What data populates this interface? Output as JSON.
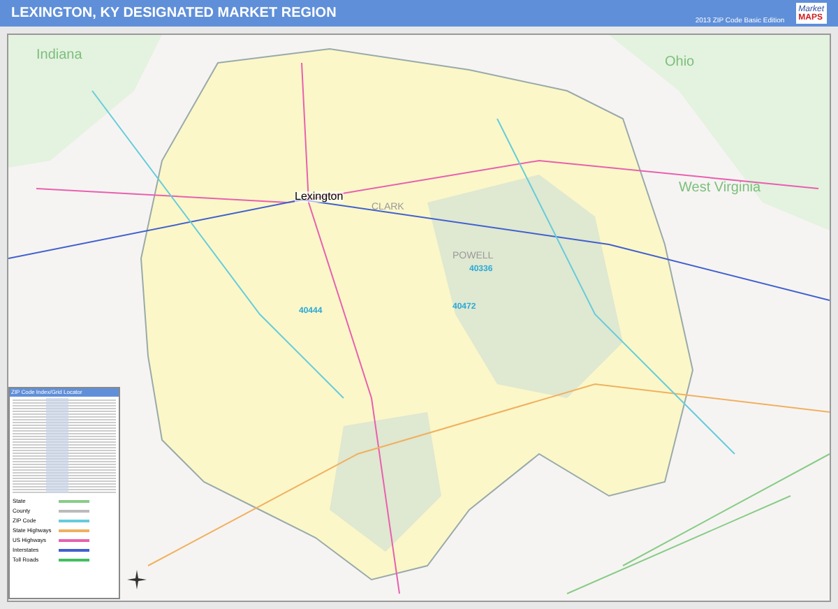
{
  "header": {
    "title": "LEXINGTON, KY DESIGNATED MARKET REGION",
    "edition": "2013 ZIP Code Basic Edition",
    "logo": [
      "Market",
      "MAPS"
    ]
  },
  "map": {
    "labels": [
      {
        "kind": "state",
        "text": "Indiana"
      },
      {
        "kind": "state",
        "text": "Ohio"
      },
      {
        "kind": "state",
        "text": "West Virginia"
      },
      {
        "kind": "city",
        "text": "Lexington"
      },
      {
        "kind": "county",
        "text": "CLARK"
      },
      {
        "kind": "county",
        "text": "POWELL"
      },
      {
        "kind": "zip",
        "text": "40444"
      },
      {
        "kind": "zip",
        "text": "40336"
      },
      {
        "kind": "zip",
        "text": "40472"
      }
    ]
  },
  "legend": {
    "index_title": "ZIP Code Index/Grid Locator",
    "items": [
      {
        "label": "State",
        "color": "#88cc88"
      },
      {
        "label": "County",
        "color": "#bbbbbb"
      },
      {
        "label": "ZIP Code",
        "color": "#66ccdd"
      },
      {
        "label": "State Highways",
        "color": "#f0b060"
      },
      {
        "label": "US Highways",
        "color": "#e860b0"
      },
      {
        "label": "Interstates",
        "color": "#4060d0"
      },
      {
        "label": "Toll Roads",
        "color": "#40c060"
      }
    ]
  }
}
